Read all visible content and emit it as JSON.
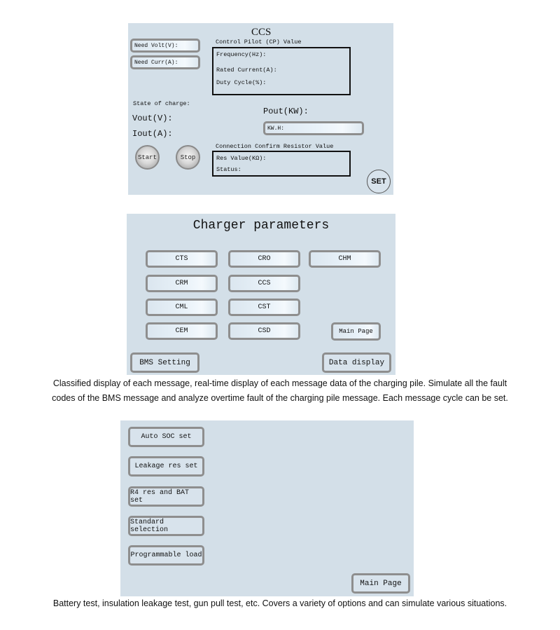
{
  "ccs_panel": {
    "title": "CCS",
    "need_volt_label": "Need Volt(V):",
    "need_curr_label": "Need Curr(A):",
    "cp_group_title": "Control Pilot (CP) Value",
    "frequency_label": "Frequency(Hz):",
    "rated_current_label": "Rated Current(A):",
    "duty_cycle_label": "Duty Cycle(%):",
    "state_of_charge_label": "State of charge:",
    "vout_label": "Vout(V):",
    "iout_label": "Iout(A):",
    "pout_label": "Pout(KW):",
    "kwh_label": "KW.H:",
    "start_button": "Start",
    "stop_button": "Stop",
    "resistor_group_title": "Connection Confirm Resistor Value",
    "res_value_label": "Res Value(KΩ):",
    "status_label": "Status:",
    "set_button": "SET"
  },
  "charger_panel": {
    "title": "Charger parameters",
    "message_buttons": [
      "CTS",
      "CRO",
      "CHM",
      "CRM",
      "CCS",
      "CML",
      "CST",
      "CEM",
      "CSD"
    ],
    "main_page_button": "Main Page",
    "bms_setting_button": "BMS Setting",
    "data_display_button": "Data display"
  },
  "caption_1": {
    "line1": "Classified display of each message, real-time display of each message data of the charging pile. Simulate all the fault",
    "line2": "codes of the BMS message and analyze overtime fault of the charging pile message. Each message cycle can be set."
  },
  "test_panel": {
    "buttons": [
      "Auto SOC set",
      "Leakage res set",
      "R4 res and BAT set",
      "Standard selection",
      "Programmable load"
    ],
    "main_page_button": "Main Page"
  },
  "caption_2": {
    "text": "Battery test, insulation leakage test, gun pull test, etc. Covers a variety of options and can simulate various situations."
  }
}
